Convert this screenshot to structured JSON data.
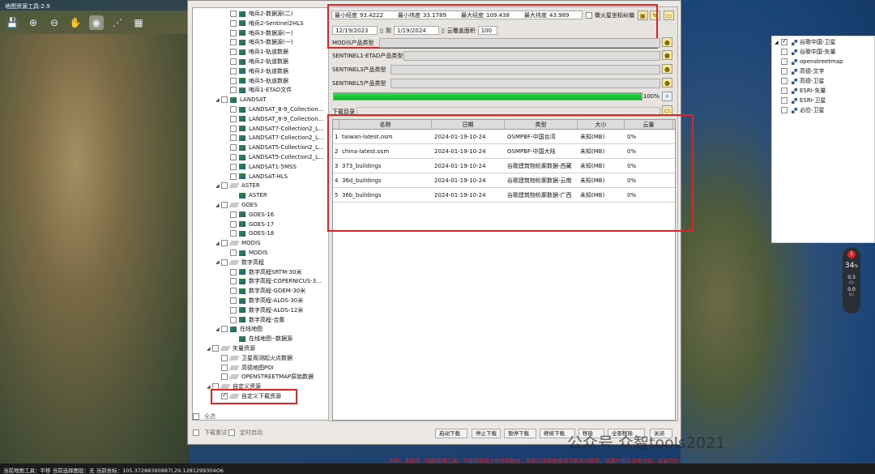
{
  "app": {
    "title": "地图资源工具-2.9"
  },
  "toolbar": [
    "save-icon",
    "zoom-in-icon",
    "zoom-out-icon",
    "pan-hand-icon",
    "locate-icon",
    "grid-tool-icon",
    "tile-tool-icon"
  ],
  "tree": [
    {
      "t": "哨兵2-数据源(二)",
      "ind": 3,
      "cb": 1,
      "ic": "layer"
    },
    {
      "t": "哨兵2-Sentinel2HLS",
      "ind": 3,
      "cb": 1,
      "ic": "layer"
    },
    {
      "t": "哨兵3-数据源(一)",
      "ind": 3,
      "cb": 1,
      "ic": "layer"
    },
    {
      "t": "哨兵5-数据源(一)",
      "ind": 3,
      "cb": 1,
      "ic": "layer"
    },
    {
      "t": "哨兵1-轨道数据",
      "ind": 3,
      "cb": 1,
      "ic": "layer"
    },
    {
      "t": "哨兵2-轨道数据",
      "ind": 3,
      "cb": 1,
      "ic": "layer"
    },
    {
      "t": "哨兵3-轨道数据",
      "ind": 3,
      "cb": 1,
      "ic": "layer"
    },
    {
      "t": "哨兵5-轨道数据",
      "ind": 3,
      "cb": 1,
      "ic": "layer"
    },
    {
      "t": "哨兵1-ETAD文件",
      "ind": 3,
      "cb": 1,
      "ic": "layer"
    },
    {
      "t": "LANDSAT",
      "ind": 2,
      "ex": "◢",
      "cb": 1,
      "ic": "layer"
    },
    {
      "t": "LANDSAT_8-9_Collection...",
      "ind": 3,
      "cb": 1,
      "ic": "layer"
    },
    {
      "t": "LANDSAT_8-9_Collection...",
      "ind": 3,
      "cb": 1,
      "ic": "layer"
    },
    {
      "t": "LANDSAT7-Collection2_L...",
      "ind": 3,
      "cb": 1,
      "ic": "layer"
    },
    {
      "t": "LANDSAT7-Collection2_L...",
      "ind": 3,
      "cb": 1,
      "ic": "layer"
    },
    {
      "t": "LANDSAT5-Collection2_L...",
      "ind": 3,
      "cb": 1,
      "ic": "layer"
    },
    {
      "t": "LANDSAT5-Collection2_L...",
      "ind": 3,
      "cb": 1,
      "ic": "layer"
    },
    {
      "t": "LANDSAT1-5MSS",
      "ind": 3,
      "cb": 1,
      "ic": "layer"
    },
    {
      "t": "LANDSAT-HLS",
      "ind": 3,
      "cb": 1,
      "ic": "layer"
    },
    {
      "t": "ASTER",
      "ind": 2,
      "ex": "◢",
      "cb": 1,
      "ic": "group"
    },
    {
      "t": "ASTER",
      "ind": 3,
      "cb": 0,
      "ic": "layer"
    },
    {
      "t": "GOES",
      "ind": 2,
      "ex": "◢",
      "cb": 1,
      "ic": "group"
    },
    {
      "t": "GOES-16",
      "ind": 3,
      "cb": 1,
      "ic": "layer"
    },
    {
      "t": "GOES-17",
      "ind": 3,
      "cb": 1,
      "ic": "layer"
    },
    {
      "t": "GOES-18",
      "ind": 3,
      "cb": 1,
      "ic": "layer"
    },
    {
      "t": "MODIS",
      "ind": 2,
      "ex": "◢",
      "cb": 1,
      "ic": "group"
    },
    {
      "t": "MODIS",
      "ind": 3,
      "cb": 1,
      "ic": "layer"
    },
    {
      "t": "数字高程",
      "ind": 2,
      "ex": "◢",
      "cb": 1,
      "ic": "group"
    },
    {
      "t": "数字高程SRTM-30米",
      "ind": 3,
      "cb": 1,
      "ic": "layer"
    },
    {
      "t": "数字高程-COPERNICUS-3...",
      "ind": 3,
      "cb": 1,
      "ic": "layer"
    },
    {
      "t": "数字高程-GDEM-30米",
      "ind": 3,
      "cb": 1,
      "ic": "layer"
    },
    {
      "t": "数字高程-ALOS-30米",
      "ind": 3,
      "cb": 1,
      "ic": "layer"
    },
    {
      "t": "数字高程-ALOS-12米",
      "ind": 3,
      "cb": 1,
      "ic": "layer"
    },
    {
      "t": "数字高程-合集",
      "ind": 3,
      "cb": 1,
      "ic": "layer"
    },
    {
      "t": "在线地图",
      "ind": 2,
      "ex": "◢",
      "cb": 1,
      "ic": "layer"
    },
    {
      "t": "在线地图--数据源",
      "ind": 3,
      "cb": 0,
      "ic": "layer"
    },
    {
      "t": "矢量资源",
      "ind": 1,
      "ex": "◢",
      "cb": 1,
      "ic": "group"
    },
    {
      "t": "卫星观测起火点数据",
      "ind": 2,
      "cb": 1,
      "ic": "group"
    },
    {
      "t": "高德地图POI",
      "ind": 2,
      "cb": 1,
      "ic": "group"
    },
    {
      "t": "OPENSTREETMAP原始数据",
      "ind": 2,
      "cb": 1,
      "ic": "group"
    },
    {
      "t": "自定义资源",
      "ind": 1,
      "ex": "◢",
      "cb": 1,
      "ic": "group"
    },
    {
      "t": "自定义下载资源",
      "ind": 2,
      "cb": 2,
      "ic": "group"
    }
  ],
  "select_all": "全选",
  "opts": {
    "retry": "下载重试",
    "schedule": "定时启动"
  },
  "params": {
    "min_lon_label": "最小经度",
    "min_lon": "93.4222",
    "min_lat_label": "最小纬度",
    "min_lat": "33.1789",
    "max_lon_label": "最大经度",
    "max_lon": "109.438",
    "max_lat_label": "最大纬度",
    "max_lat": "43.989",
    "mars_label": "做火星坐标纠偏",
    "date_from": "12/19/2023",
    "to_label": "到",
    "date_to": "1/19/2024",
    "cloud_label": "云覆盖面积",
    "cloud": "100",
    "modis_label": "MODIS产品类型",
    "s1_label": "SENTINEL1-ETAD产品类型",
    "s3_label": "SENTINEL3产品类型",
    "s5_label": "SENTINEL5产品类型",
    "progress_text": "100%",
    "progress": 1.0,
    "dir_label": "下载目录"
  },
  "grid": {
    "headers": [
      "名称",
      "日期",
      "类型",
      "大小",
      "云量"
    ],
    "rows": [
      [
        "1",
        "taiwan-latest.osm",
        "2024-01-19-10-24",
        "OSMPBF-中国台湾",
        "未知(MB)",
        "0%"
      ],
      [
        "2",
        "china-latest.osm",
        "2024-01-19-10-24",
        "OSMPBF-中国大陆",
        "未知(MB)",
        "0%"
      ],
      [
        "3",
        "373_buildings",
        "2024-01-19-10-24",
        "谷歌建筑物轮廓数据-西藏",
        "未知(MB)",
        "0%"
      ],
      [
        "4",
        "36d_buildings",
        "2024-01-19-10-24",
        "谷歌建筑物轮廓数据-云南",
        "未知(MB)",
        "0%"
      ],
      [
        "5",
        "36b_buildings",
        "2024-01-19-10-24",
        "谷歌建筑物轮廓数据-广西",
        "未知(MB)",
        "0%"
      ]
    ]
  },
  "buttons": [
    "启动下载",
    "停止下载",
    "暂停下载",
    "继续下载",
    "移除",
    "全部移除",
    "关闭"
  ],
  "layers": [
    {
      "t": "谷歌中国-卫星",
      "on": true
    },
    {
      "t": "谷歌中国-矢量",
      "on": false
    },
    {
      "t": "openstreetmap",
      "on": false
    },
    {
      "t": "高德-文字",
      "on": false
    },
    {
      "t": "高德-卫星",
      "on": false
    },
    {
      "t": "ESRI-矢量",
      "on": false
    },
    {
      "t": "ESRI-卫星",
      "on": false
    },
    {
      "t": "必应-卫星",
      "on": false
    }
  ],
  "widget": {
    "badge": "1",
    "value": "34",
    "unit": "%",
    "up": "0.3",
    "up_unit": "K/s",
    "down": "0.0",
    "down_unit": "K/s"
  },
  "status": {
    "text": "当前地图工具：平移  当前选择图层：无  当前坐标：105.37288390887l,29.1281299304O6"
  },
  "promo": "声明：本软件（地图资源工具）不会存储或上传任何数据，系统仅作数据查询下载测试使用，请遵守相关法律法规，非诚勿扰！",
  "watermark": "公众号 众智tools2021",
  "colors": {
    "highlight": "#e02424",
    "progress": "#1cc43a"
  }
}
